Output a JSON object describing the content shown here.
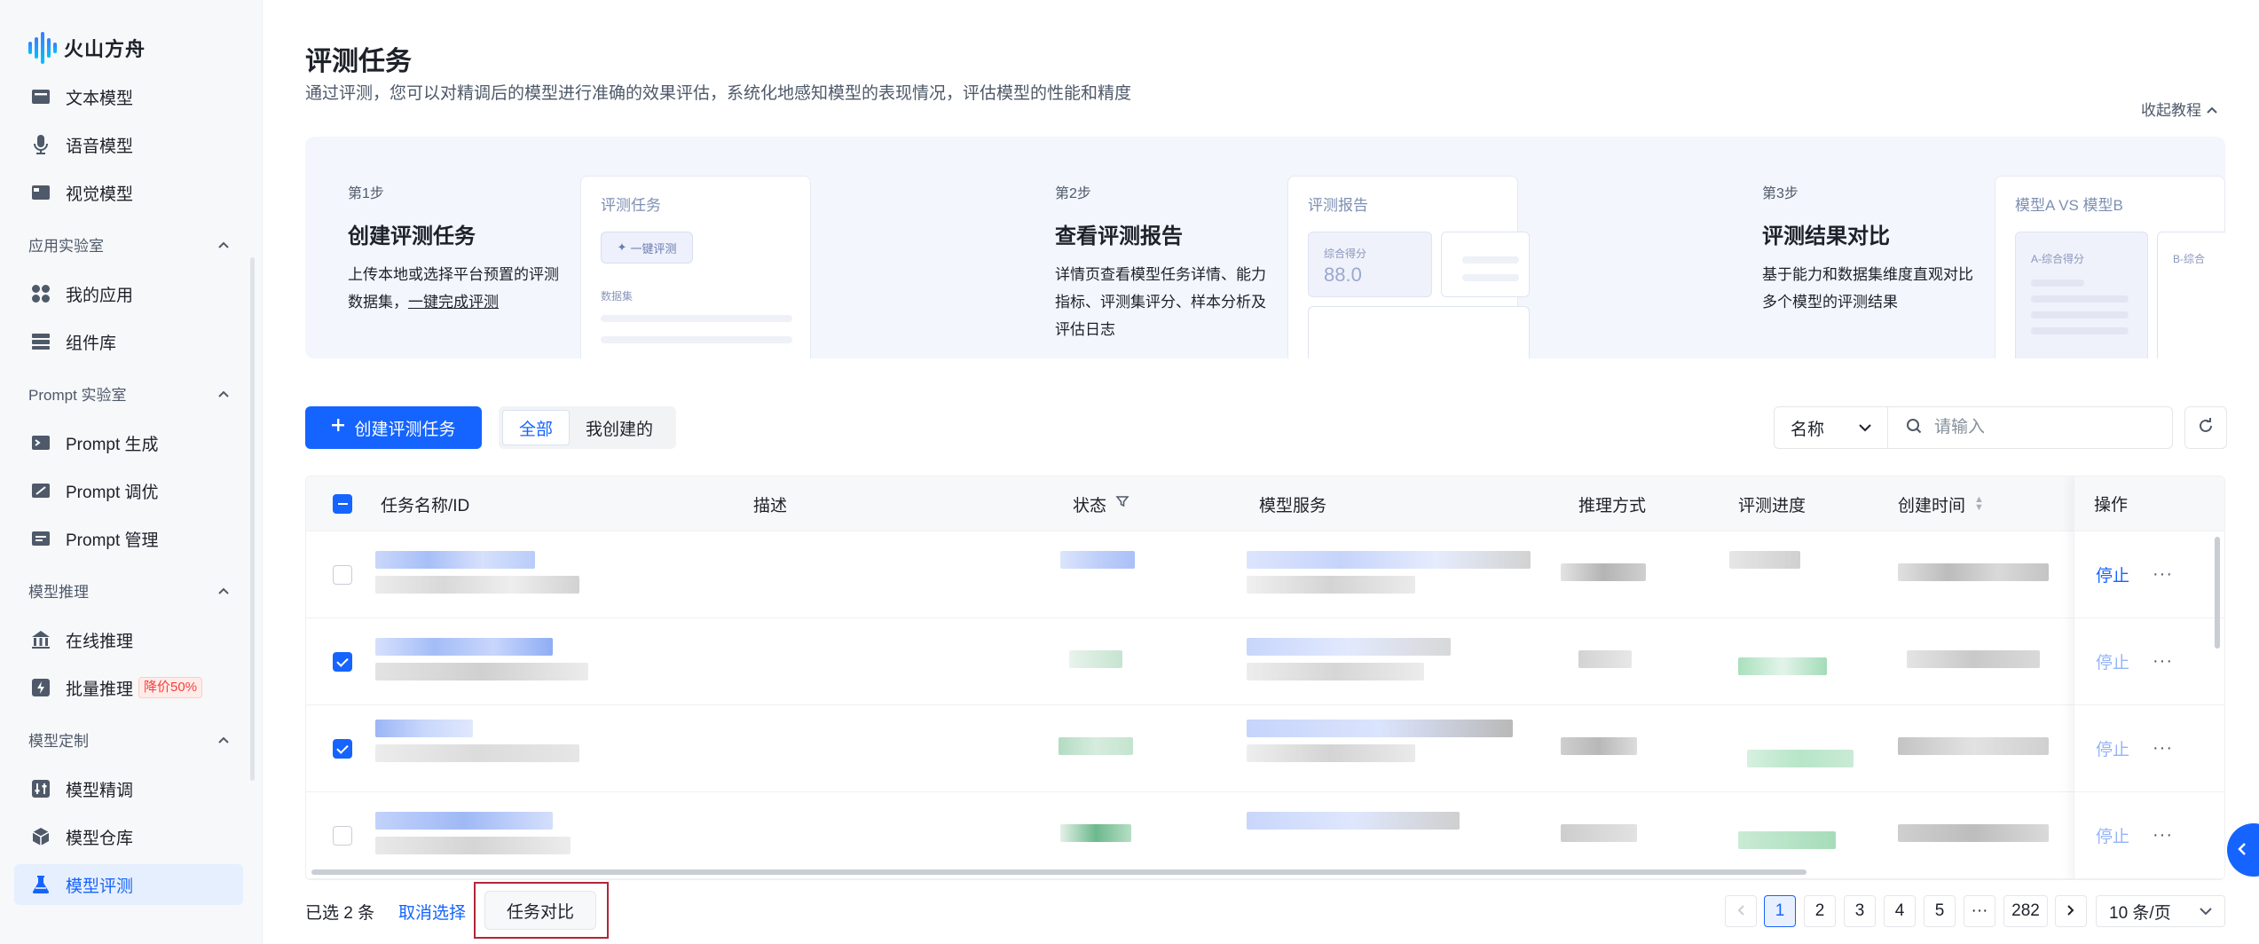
{
  "brand": {
    "name": "火山方舟"
  },
  "sidebar": {
    "top_items": [
      {
        "label": "文本模型",
        "icon": "text-model-icon"
      },
      {
        "label": "语音模型",
        "icon": "microphone-icon"
      },
      {
        "label": "视觉模型",
        "icon": "vision-model-icon"
      }
    ],
    "groups": [
      {
        "label": "应用实验室",
        "items": [
          {
            "label": "我的应用"
          },
          {
            "label": "组件库"
          }
        ]
      },
      {
        "label": "Prompt 实验室",
        "items": [
          {
            "label": "Prompt 生成"
          },
          {
            "label": "Prompt 调优"
          },
          {
            "label": "Prompt 管理"
          }
        ]
      },
      {
        "label": "模型推理",
        "items": [
          {
            "label": "在线推理"
          },
          {
            "label": "批量推理",
            "badge": "降价50%"
          }
        ]
      },
      {
        "label": "模型定制",
        "items": [
          {
            "label": "模型精调"
          },
          {
            "label": "模型仓库"
          },
          {
            "label": "模型评测"
          }
        ]
      }
    ]
  },
  "header": {
    "title": "评测任务",
    "description": "通过评测，您可以对精调后的模型进行准确的效果评估，系统化地感知模型的表现情况，评估模型的性能和精度",
    "collapse_label": "收起教程"
  },
  "steps": [
    {
      "num": "第1步",
      "title": "创建评测任务",
      "desc_prefix": "上传本地或选择平台预置的评测数据集，",
      "desc_link": "一键完成评测",
      "mock_title": "评测任务",
      "mock_button": "一键评测",
      "mock_label": "数据集"
    },
    {
      "num": "第2步",
      "title": "查看评测报告",
      "desc": "详情页查看模型任务详情、能力指标、评测集评分、样本分析及评估日志",
      "mock_title": "评测报告",
      "mock_label": "综合得分",
      "mock_value": "88.0"
    },
    {
      "num": "第3步",
      "title": "评测结果对比",
      "desc": "基于能力和数据集维度直观对比多个模型的评测结果",
      "mock_title": "模型A VS 模型B",
      "mock_label_a": "A-综合得分",
      "mock_label_b": "B-综合"
    }
  ],
  "toolbar": {
    "create_label": "创建评测任务",
    "segments": [
      {
        "label": "全部",
        "active": true
      },
      {
        "label": "我创建的",
        "active": false
      }
    ],
    "filter_field": "名称",
    "search_placeholder": "请输入"
  },
  "table": {
    "columns": {
      "name": "任务名称/ID",
      "desc": "描述",
      "status": "状态",
      "service": "模型服务",
      "infer": "推理方式",
      "progress": "评测进度",
      "created": "创建时间",
      "ops": "操作"
    },
    "rows": [
      {
        "checked": false,
        "action": "停止",
        "action_enabled": true
      },
      {
        "checked": true,
        "action": "停止",
        "action_enabled": false
      },
      {
        "checked": true,
        "action": "停止",
        "action_enabled": false
      },
      {
        "checked": false,
        "action": "停止",
        "action_enabled": false
      }
    ],
    "more_label": "···"
  },
  "footer": {
    "selected_prefix": "已选",
    "selected_count": "2",
    "selected_suffix": "条",
    "cancel_label": "取消选择",
    "compare_label": "任务对比",
    "pages": [
      "1",
      "2",
      "3",
      "4",
      "5",
      "···",
      "282"
    ],
    "current_page": "1",
    "page_size": "10 条/页"
  },
  "colors": {
    "primary": "#1664ff",
    "badge_red": "#f53f3f",
    "highlight_frame": "#b0273a"
  }
}
